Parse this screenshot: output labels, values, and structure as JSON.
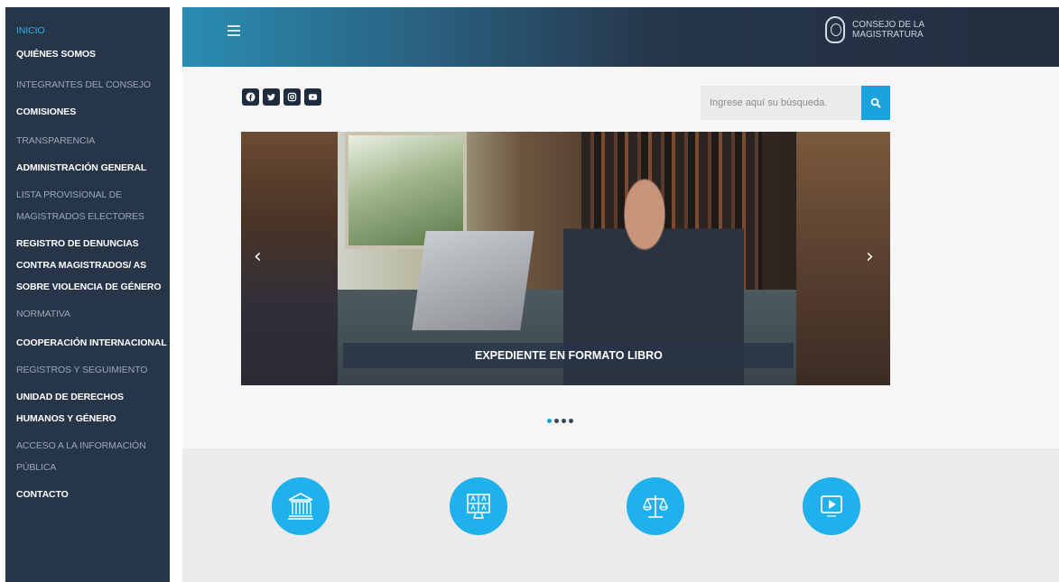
{
  "sidebar": {
    "items": [
      {
        "lines": [
          "INICIO"
        ],
        "style": "active"
      },
      {
        "lines": [
          "QUIÉNES SOMOS"
        ],
        "style": "bold"
      },
      {
        "lines": [
          "INTEGRANTES DEL CONSEJO"
        ],
        "style": "dim"
      },
      {
        "lines": [
          "COMISIONES"
        ],
        "style": "bold"
      },
      {
        "lines": [
          "TRANSPARENCIA"
        ],
        "style": "dim"
      },
      {
        "lines": [
          "ADMINISTRACIÓN GENERAL"
        ],
        "style": "bold"
      },
      {
        "lines": [
          "LISTA PROVISIONAL DE",
          "MAGISTRADOS ELECTORES"
        ],
        "style": "dim"
      },
      {
        "lines": [
          "REGISTRO DE DENUNCIAS",
          "CONTRA MAGISTRADOS/ AS",
          "SOBRE VIOLENCIA DE GÉNERO"
        ],
        "style": "bold"
      },
      {
        "lines": [
          "NORMATIVA"
        ],
        "style": "dim"
      },
      {
        "lines": [
          "COOPERACIÓN INTERNACIONAL"
        ],
        "style": "bold"
      },
      {
        "lines": [
          "REGISTROS Y SEGUIMIENTO"
        ],
        "style": "dim"
      },
      {
        "lines": [
          "UNIDAD DE DERECHOS",
          "HUMANOS Y GÉNERO"
        ],
        "style": "bold"
      },
      {
        "lines": [
          "ACCESO A LA INFORMACIÓN",
          "PÚBLICA"
        ],
        "style": "dim"
      },
      {
        "lines": [
          "CONTACTO"
        ],
        "style": "bold"
      }
    ]
  },
  "header": {
    "brand_line1": "CONSEJO DE LA",
    "brand_line2": "MAGISTRATURA",
    "menu_icon": "hamburger-menu-icon"
  },
  "social": [
    "facebook-icon",
    "twitter-icon",
    "instagram-icon",
    "youtube-icon"
  ],
  "search": {
    "placeholder": "Ingrese aquí su búsqueda.",
    "value": "",
    "button_icon": "search-icon"
  },
  "carousel": {
    "caption": "EXPEDIENTE EN FORMATO LIBRO",
    "prev_symbol": "‹",
    "next_symbol": "›",
    "slide_count": 4,
    "active_slide": 1
  },
  "features": [
    "courthouse-icon",
    "ballot-board-icon",
    "scales-icon",
    "video-play-icon"
  ],
  "colors": {
    "sidebar_bg": "#263548",
    "accent": "#1aa3df",
    "feature_circle": "#1fb1ec",
    "header_dark": "#232f41"
  }
}
